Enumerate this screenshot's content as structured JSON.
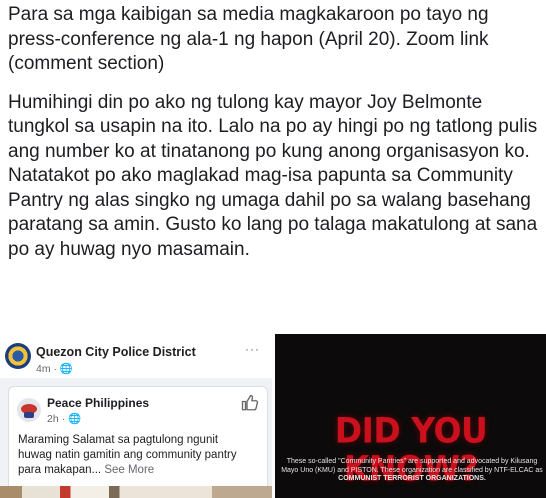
{
  "post": {
    "paragraph1": "Para sa mga kaibigan sa media magkakaroon po tayo ng press-conference ng ala-1 ng hapon (April 20). Zoom link (comment section)",
    "paragraph2": "Humihingi din po ako ng tulong kay mayor Joy Belmonte tungkol sa usapin na ito. Lalo na po ay hingi po ng tatlong pulis ang number ko at tinatanong po kung anong organisasyon ko. Natatakot po ako maglakad mag-isa papunta sa Community Pantry  ng alas singko ng umaga dahil po sa walang basehang paratang sa amin. Gusto ko lang po talaga makatulong at sana po ay huwag nyo masamain."
  },
  "left_screenshot": {
    "page_name": "Quezon City Police District",
    "page_time": "4m · 🌐",
    "more": "···",
    "shared_post": {
      "author": "Peace Philippines",
      "time": "2h · 🌐",
      "text": "Maraming Salamat sa pagtulong ngunit huwag natin gamitin ang community pantry para makapan... ",
      "see_more": "See More"
    }
  },
  "right_screenshot": {
    "headline": "DID YOU KNOW?",
    "caption": "These so-called \"Community Pantries\" are supported and advocated by Kilusang Mayo Uno (KMU) and PISTON. These organization are classified by NTF-ELCAC as ",
    "caption_emphasis": "COMMUNIST TERRORIST ORGANIZATIONS."
  },
  "colors": {
    "text": "#1c1e21",
    "muted": "#65676b",
    "headline_red": "#c9101c",
    "dark_bg": "#0c0a0a"
  },
  "icons": [
    "globe-icon",
    "like-icon",
    "more-icon",
    "page-logo",
    "avatar"
  ]
}
